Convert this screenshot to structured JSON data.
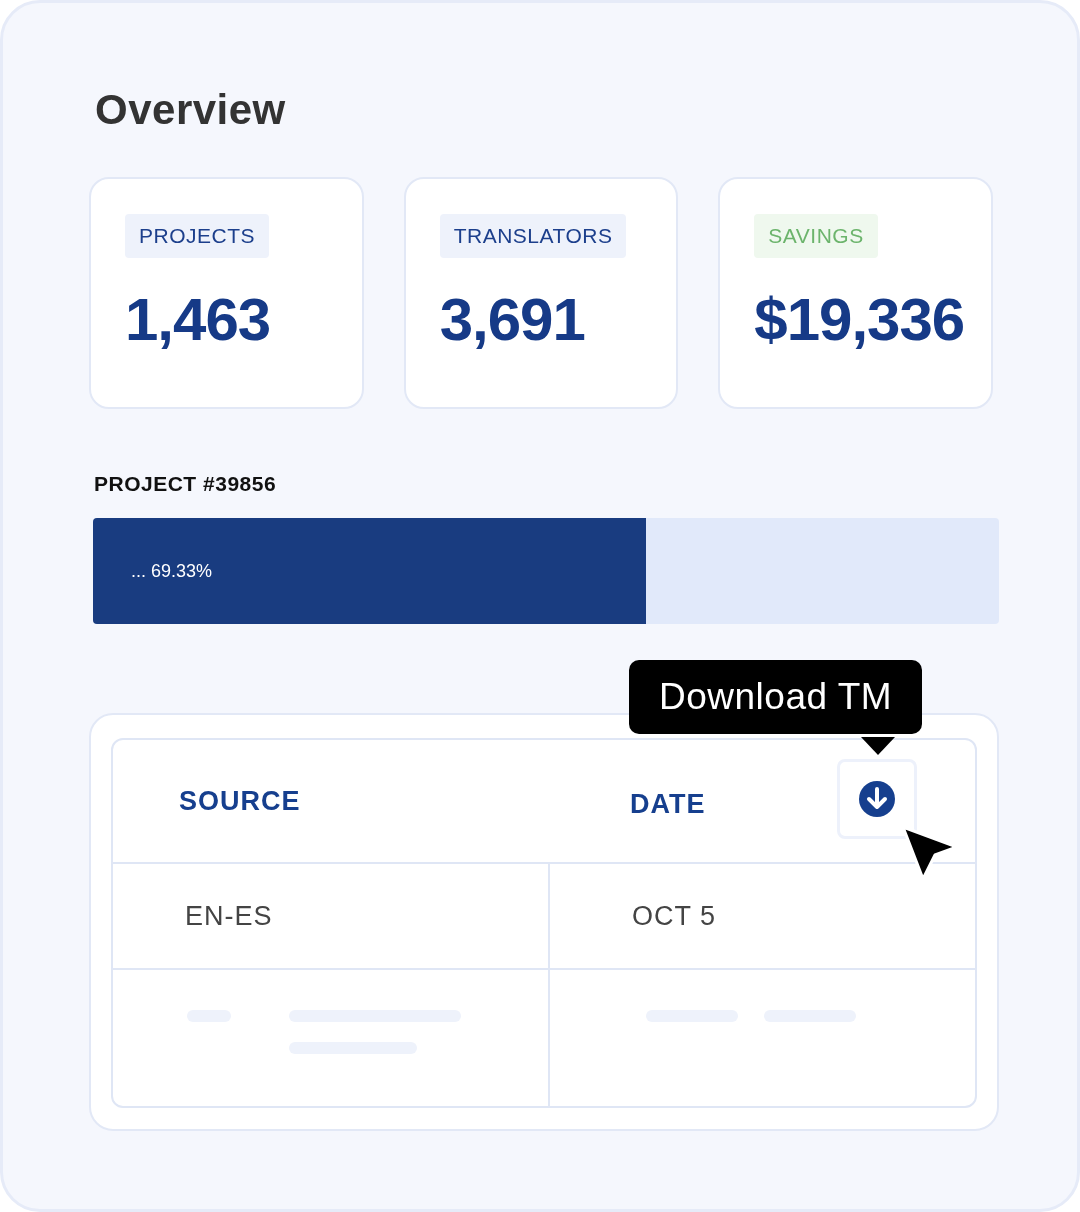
{
  "title": "Overview",
  "stats": [
    {
      "label": "PROJECTS",
      "value": "1,463",
      "kind": "neutral"
    },
    {
      "label": "TRANSLATORS",
      "value": "3,691",
      "kind": "neutral"
    },
    {
      "label": "SAVINGS",
      "value": "$19,336",
      "kind": "positive"
    }
  ],
  "project": {
    "label": "PROJECT #39856",
    "level": 0.61,
    "reading": "... 69.33%"
  },
  "table": {
    "columns": [
      "SOURCE",
      "DATE"
    ],
    "rows": [
      [
        "EN-ES",
        "OCT 5"
      ]
    ]
  },
  "tooltip": "Download TM"
}
